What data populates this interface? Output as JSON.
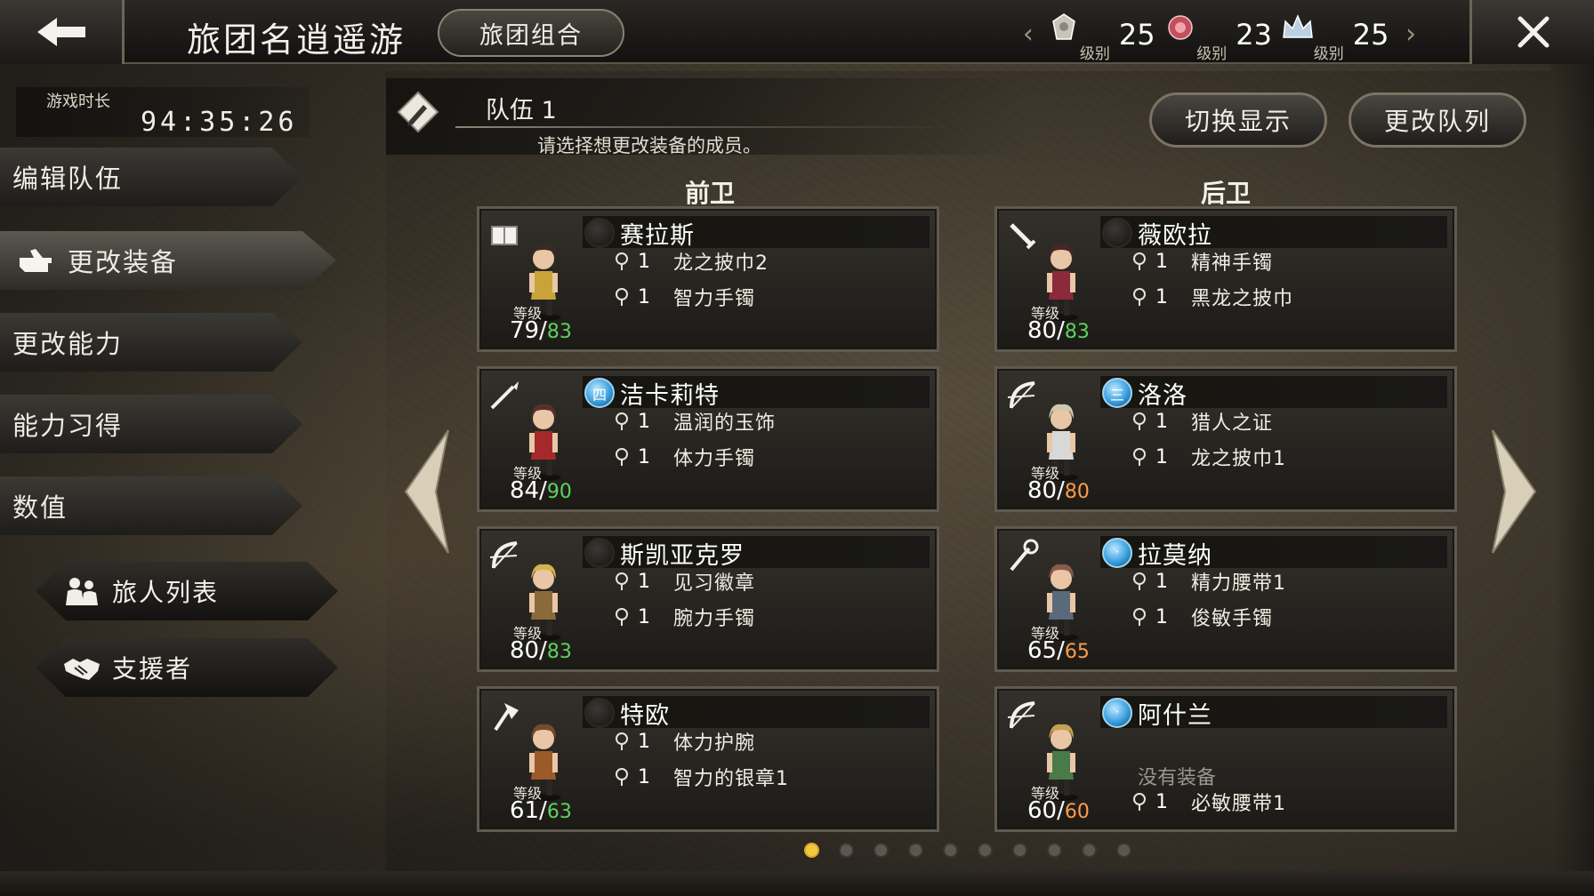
{
  "header": {
    "title": "旅团名逍遥游",
    "guild_button": "旅团组合",
    "ranks": [
      {
        "label": "级别",
        "value": "25",
        "emblem": "crest-silver"
      },
      {
        "label": "级别",
        "value": "23",
        "emblem": "crest-rose"
      },
      {
        "label": "级别",
        "value": "25",
        "emblem": "crest-crown"
      }
    ]
  },
  "playtime": {
    "label": "游戏时长",
    "value": "94:35:26"
  },
  "menu": [
    {
      "label": "编辑队伍"
    },
    {
      "label": "更改装备"
    },
    {
      "label": "更改能力"
    },
    {
      "label": "能力习得"
    },
    {
      "label": "数值"
    }
  ],
  "sub_buttons": [
    {
      "label": "旅人列表",
      "icon": "travelers-icon"
    },
    {
      "label": "支援者",
      "icon": "handshake-icon"
    }
  ],
  "team": {
    "name": "队伍 1",
    "hint": "请选择想更改装备的成员。",
    "switch_button": "切换显示",
    "formation_button": "更改队列"
  },
  "columns": {
    "front": "前卫",
    "back": "后卫"
  },
  "lvl_label": "等级",
  "front": [
    {
      "name": "赛拉斯",
      "level": "79",
      "max": "83",
      "weapon": "tome-icon",
      "gem": "",
      "items": [
        {
          "qty": "1",
          "name": "龙之披巾2"
        },
        {
          "qty": "1",
          "name": "智力手镯"
        }
      ]
    },
    {
      "name": "洁卡莉特",
      "level": "84",
      "max": "90",
      "weapon": "spear-icon",
      "gem": "四",
      "items": [
        {
          "qty": "1",
          "name": "温润的玉饰"
        },
        {
          "qty": "1",
          "name": "体力手镯"
        }
      ]
    },
    {
      "name": "斯凯亚克罗",
      "level": "80",
      "max": "83",
      "weapon": "bow-icon",
      "gem": "",
      "items": [
        {
          "qty": "1",
          "name": "见习徽章"
        },
        {
          "qty": "1",
          "name": "腕力手镯"
        }
      ]
    },
    {
      "name": "特欧",
      "level": "61",
      "max": "63",
      "weapon": "axe-icon",
      "gem": "",
      "items": [
        {
          "qty": "1",
          "name": "体力护腕"
        },
        {
          "qty": "1",
          "name": "智力的银章1"
        }
      ]
    }
  ],
  "back": [
    {
      "name": "薇欧拉",
      "level": "80",
      "max": "83",
      "weapon": "dagger-icon",
      "gem": "",
      "items": [
        {
          "qty": "1",
          "name": "精神手镯"
        },
        {
          "qty": "1",
          "name": "黑龙之披巾"
        }
      ]
    },
    {
      "name": "洛洛",
      "level": "80",
      "max": "80",
      "weapon": "bow-icon",
      "gem": "三",
      "items": [
        {
          "qty": "1",
          "name": "猎人之证"
        },
        {
          "qty": "1",
          "name": "龙之披巾1"
        }
      ]
    },
    {
      "name": "拉莫纳",
      "level": "65",
      "max": "65",
      "weapon": "staff-icon",
      "gem": "·",
      "items": [
        {
          "qty": "1",
          "name": "精力腰带1"
        },
        {
          "qty": "1",
          "name": "俊敏手镯"
        }
      ]
    },
    {
      "name": "阿什兰",
      "level": "60",
      "max": "60",
      "weapon": "bow-icon",
      "gem": "·",
      "no_equip": "没有装备",
      "items": [
        {
          "qty": "1",
          "name": "必敏腰带1"
        }
      ]
    }
  ],
  "page_dots": {
    "count": 10,
    "active": 0
  },
  "colors": {
    "level_max_green": "#5bd45b",
    "level_max_capped": "#ff9c48",
    "gem_blue": "#3aa0e0",
    "dot_active": "#f4c83c"
  }
}
